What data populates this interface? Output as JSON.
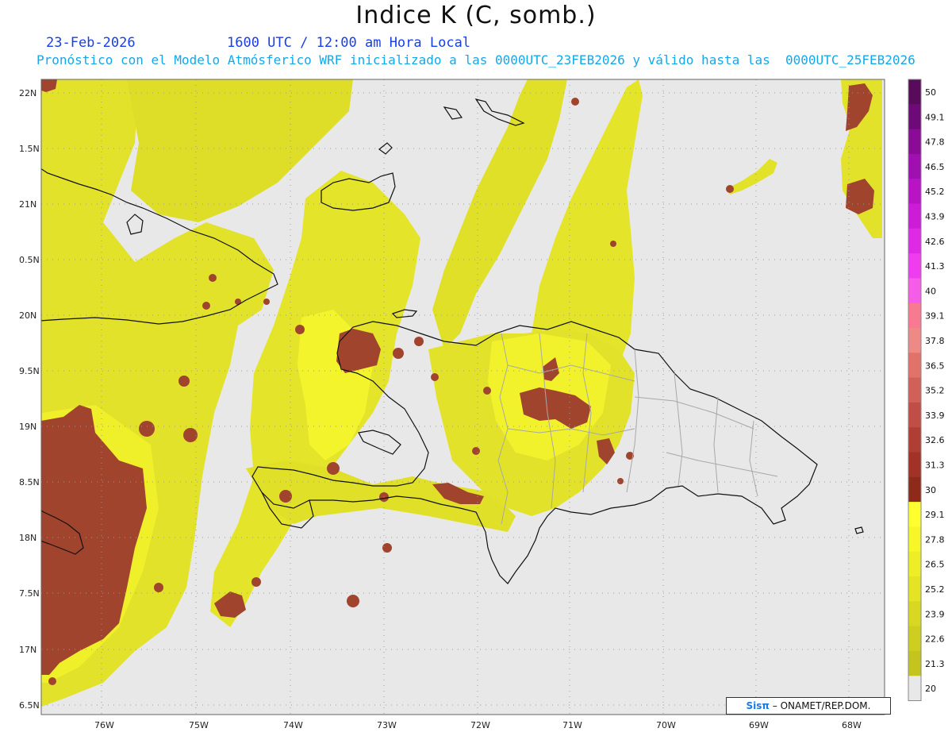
{
  "title": "Indice K (C, somb.)",
  "date": "23-Feb-2026",
  "time": "1600 UTC / 12:00 am Hora Local",
  "subtitle": "Pronóstico con el Modelo Atmósferico WRF inicializado a las 0000UTC_23FEB2026 y válido hasta las  0000UTC_25FEB2026",
  "lat_labels": [
    "22N",
    "1.5N",
    "21N",
    "0.5N",
    "20N",
    "9.5N",
    "19N",
    "8.5N",
    "18N",
    "7.5N",
    "17N",
    "6.5N"
  ],
  "lon_labels": [
    "76W",
    "75W",
    "74W",
    "73W",
    "72W",
    "71W",
    "70W",
    "69W",
    "68W"
  ],
  "colorbar": {
    "levels": [
      "50",
      "49.1",
      "47.8",
      "46.5",
      "45.2",
      "43.9",
      "42.6",
      "41.3",
      "40",
      "39.1",
      "37.8",
      "36.5",
      "35.2",
      "33.9",
      "32.6",
      "31.3",
      "30",
      "29.1",
      "27.8",
      "26.5",
      "25.2",
      "23.9",
      "22.6",
      "21.3",
      "20"
    ],
    "colors": [
      "#5a0a5a",
      "#6e0a78",
      "#8a0c96",
      "#a010b0",
      "#b814c6",
      "#cc1cd8",
      "#de2ae4",
      "#ee3cee",
      "#f55ce8",
      "#f77a90",
      "#ee8a86",
      "#e0726a",
      "#d06058",
      "#c04e46",
      "#b03e34",
      "#a23228",
      "#8e2a1a",
      "#ffff30",
      "#f6f628",
      "#eeee26",
      "#e4e424",
      "#d8d822",
      "#cece20",
      "#c4c41e",
      "#e8e8e8"
    ]
  },
  "colors": {
    "background": "#e8e8e8",
    "k_yellow": "#e2e22a",
    "k_bright": "#f4f42c",
    "k_brown": "#a0442e",
    "title_blue": "#1a3ee8",
    "subtitle_blue": "#14a8ea"
  },
  "credit": {
    "logo": "Sisπ",
    "text": "– ONAMET/REP.DOM."
  }
}
